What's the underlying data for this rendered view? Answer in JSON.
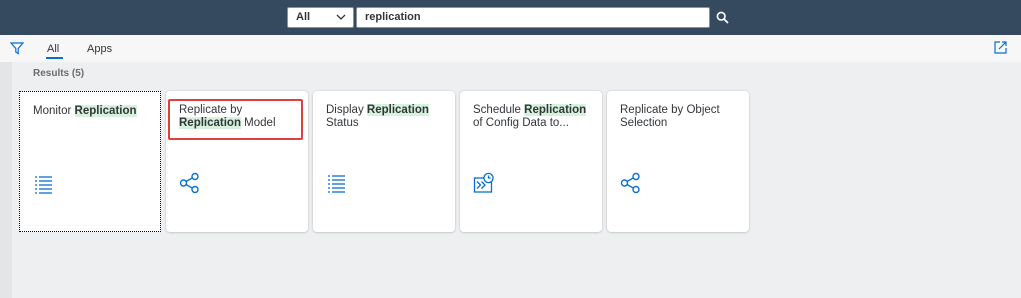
{
  "topbar": {
    "scope_label": "All",
    "search_value": "replication"
  },
  "subbar": {
    "tab_all": "All",
    "tab_apps": "Apps"
  },
  "results_label": "Results (5)",
  "tiles": [
    {
      "parts": [
        "Monitor ",
        "Replication",
        ""
      ],
      "icon": "list-icon"
    },
    {
      "parts": [
        "Replicate by ",
        "Replication",
        " Model"
      ],
      "icon": "share-nodes-icon"
    },
    {
      "parts": [
        "Display ",
        "Replication",
        " Status"
      ],
      "icon": "list-icon"
    },
    {
      "parts": [
        "Schedule ",
        "Replication",
        " of Config Data to..."
      ],
      "icon": "schedule-run-icon"
    },
    {
      "parts": [
        "Replicate by Object Selection",
        "",
        ""
      ],
      "icon": "share-nodes-icon"
    }
  ],
  "colors": {
    "topbar": "#354a5f",
    "icon_blue": "#0a6ed1",
    "highlight": "#d7f2dc",
    "annotation": "#e03f3f"
  }
}
